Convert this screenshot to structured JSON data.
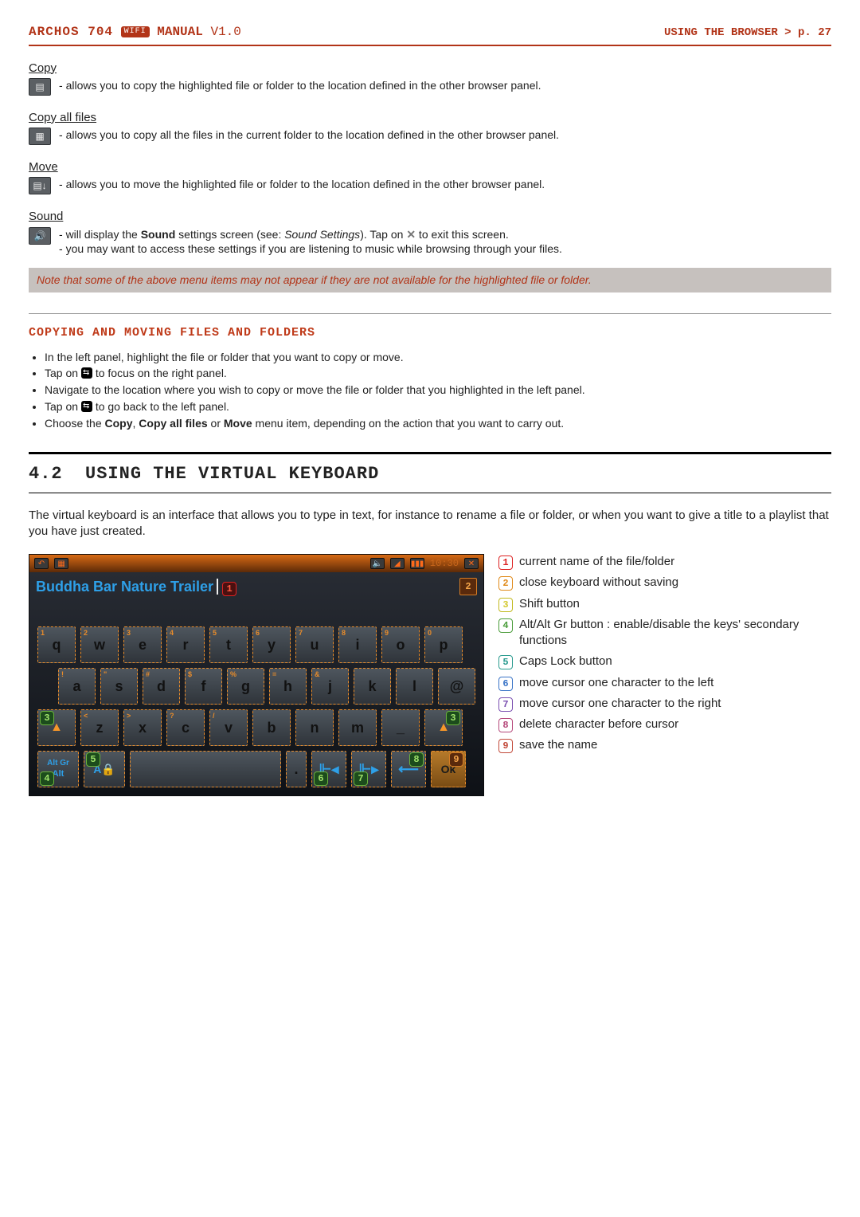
{
  "header": {
    "brand": "ARCHOS 704",
    "wifi": "WIFI",
    "manual": "MANUAL",
    "version": "V1.0",
    "section": "USING THE BROWSER",
    "chev": ">",
    "page": "p. 27"
  },
  "defs": {
    "copy": {
      "title": "Copy",
      "text": "allows you to copy the highlighted file or folder to the location defined in the other browser panel."
    },
    "copy_all": {
      "title": "Copy all files",
      "text": "allows you to copy all the files in the current folder to the location defined in the other browser panel."
    },
    "move": {
      "title": "Move",
      "text": "allows you to move the highlighted file or folder to the location defined in the other browser panel."
    },
    "sound": {
      "title": "Sound",
      "line1a": "will display the ",
      "line1b": "Sound",
      "line1c": " settings screen (see: ",
      "line1d": "Sound Settings",
      "line1e": "). Tap on ",
      "line1f": " to exit this screen.",
      "line2": "you may want to access these settings if you are listening to music while browsing through your files."
    }
  },
  "note": "Note that some of the above menu items may not appear if they are not available for the highlighted file or folder.",
  "subsection": "COPYING AND MOVING FILES AND FOLDERS",
  "bullets": {
    "b1": "In the left panel, highlight the file or folder that you want to copy or move.",
    "b2a": "Tap on ",
    "b2b": " to focus on the right panel.",
    "b3": "Navigate to the location where you wish to copy or move the file or folder that you highlighted in the left panel.",
    "b4a": "Tap on ",
    "b4b": " to go back to the left panel.",
    "b5a": "Choose the ",
    "b5b": "Copy",
    "b5c": ", ",
    "b5d": "Copy all files",
    "b5e": " or ",
    "b5f": "Move",
    "b5g": " menu item, depending on the action that you want to carry out."
  },
  "chapter": {
    "num": "4.2",
    "title": "USING THE VIRTUAL KEYBOARD"
  },
  "lead": "The virtual keyboard is an interface that allows you to type in text, for instance to rename a file or folder, or when you want to give a title to a playlist that you have just created.",
  "kb": {
    "time": "10:30",
    "name": "Buddha Bar Nature Trailer",
    "row1": {
      "k1": "q",
      "k2": "w",
      "k3": "e",
      "k4": "r",
      "k5": "t",
      "k6": "y",
      "k7": "u",
      "k8": "i",
      "k9": "o",
      "k10": "p"
    },
    "row1_top": {
      "k1": "1",
      "k2": "2",
      "k3": "3",
      "k4": "4",
      "k5": "5",
      "k6": "6",
      "k7": "7",
      "k8": "8",
      "k9": "9",
      "k10": "0"
    },
    "row2": {
      "k1": "a",
      "k2": "s",
      "k3": "d",
      "k4": "f",
      "k5": "g",
      "k6": "h",
      "k7": "j",
      "k8": "k",
      "k9": "l",
      "k10": "@"
    },
    "row2_top": {
      "k1": "!",
      "k2": "\"",
      "k3": "#",
      "k4": "$",
      "k5": "%",
      "k6": "=",
      "k7": "&",
      "k8": "",
      "k9": "",
      "k10": ""
    },
    "row3": {
      "shift": "⇧",
      "k1": "z",
      "k2": "x",
      "k3": "c",
      "k4": "v",
      "k5": "b",
      "k6": "n",
      "k7": "m",
      "k8": "_",
      "shift2": "⇧"
    },
    "row3_top": {
      "k1": "<",
      "k2": ">",
      "k3": "?",
      "k4": "/",
      "k5": "",
      "k6": "",
      "k7": "",
      "k8": ""
    },
    "row4": {
      "altgr": "Alt Gr",
      "alt": "Alt",
      "caps": "A",
      "dot": ".",
      "left": "◂",
      "right": "▸",
      "del": "←",
      "ok": "Ok"
    },
    "badges": {
      "n1": "1",
      "n2": "2",
      "n3": "3",
      "n4": "4",
      "n5": "5",
      "n6": "6",
      "n7": "7",
      "n8": "8",
      "n9": "9"
    }
  },
  "legend": {
    "i1": "current name of the file/folder",
    "i2": "close keyboard without saving",
    "i3": "Shift button",
    "i4": "Alt/Alt Gr button : enable/disable the keys' secondary functions",
    "i5": "Caps Lock button",
    "i6": "move cursor one character to the left",
    "i7": "move cursor one character to the right",
    "i8": "delete character before cursor",
    "i9": "save the name"
  }
}
